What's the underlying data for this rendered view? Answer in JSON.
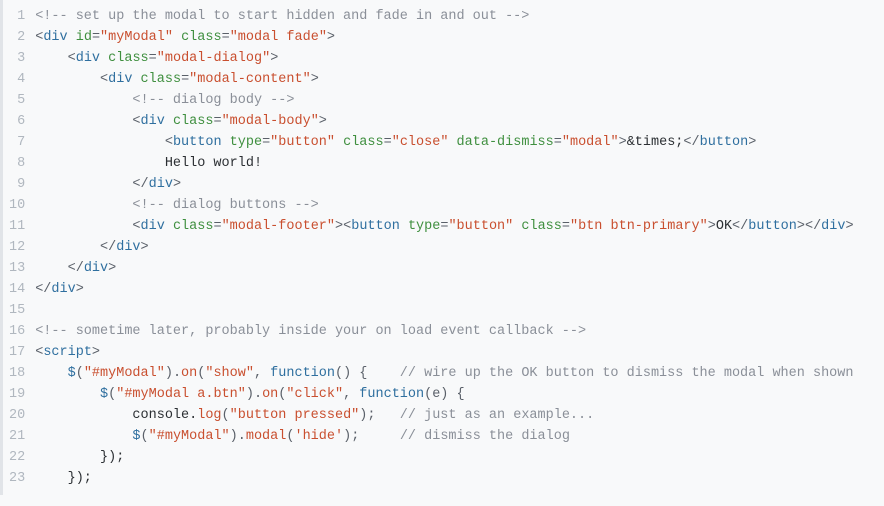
{
  "lineCount": 23,
  "lines": [
    [
      {
        "cls": "c",
        "t": "<!-- set up the modal to start hidden and fade in and out -->"
      }
    ],
    [
      {
        "cls": "p",
        "t": "<"
      },
      {
        "cls": "t",
        "t": "div"
      },
      {
        "cls": "n",
        "t": " "
      },
      {
        "cls": "a",
        "t": "id"
      },
      {
        "cls": "p",
        "t": "="
      },
      {
        "cls": "s",
        "t": "\"myModal\""
      },
      {
        "cls": "n",
        "t": " "
      },
      {
        "cls": "a",
        "t": "class"
      },
      {
        "cls": "p",
        "t": "="
      },
      {
        "cls": "s",
        "t": "\"modal fade\""
      },
      {
        "cls": "p",
        "t": ">"
      }
    ],
    [
      {
        "cls": "n",
        "t": "    "
      },
      {
        "cls": "p",
        "t": "<"
      },
      {
        "cls": "t",
        "t": "div"
      },
      {
        "cls": "n",
        "t": " "
      },
      {
        "cls": "a",
        "t": "class"
      },
      {
        "cls": "p",
        "t": "="
      },
      {
        "cls": "s",
        "t": "\"modal-dialog\""
      },
      {
        "cls": "p",
        "t": ">"
      }
    ],
    [
      {
        "cls": "n",
        "t": "        "
      },
      {
        "cls": "p",
        "t": "<"
      },
      {
        "cls": "t",
        "t": "div"
      },
      {
        "cls": "n",
        "t": " "
      },
      {
        "cls": "a",
        "t": "class"
      },
      {
        "cls": "p",
        "t": "="
      },
      {
        "cls": "s",
        "t": "\"modal-content\""
      },
      {
        "cls": "p",
        "t": ">"
      }
    ],
    [
      {
        "cls": "n",
        "t": "            "
      },
      {
        "cls": "c",
        "t": "<!-- dialog body -->"
      }
    ],
    [
      {
        "cls": "n",
        "t": "            "
      },
      {
        "cls": "p",
        "t": "<"
      },
      {
        "cls": "t",
        "t": "div"
      },
      {
        "cls": "n",
        "t": " "
      },
      {
        "cls": "a",
        "t": "class"
      },
      {
        "cls": "p",
        "t": "="
      },
      {
        "cls": "s",
        "t": "\"modal-body\""
      },
      {
        "cls": "p",
        "t": ">"
      }
    ],
    [
      {
        "cls": "n",
        "t": "                "
      },
      {
        "cls": "p",
        "t": "<"
      },
      {
        "cls": "t",
        "t": "button"
      },
      {
        "cls": "n",
        "t": " "
      },
      {
        "cls": "a",
        "t": "type"
      },
      {
        "cls": "p",
        "t": "="
      },
      {
        "cls": "s",
        "t": "\"button\""
      },
      {
        "cls": "n",
        "t": " "
      },
      {
        "cls": "a",
        "t": "class"
      },
      {
        "cls": "p",
        "t": "="
      },
      {
        "cls": "s",
        "t": "\"close\""
      },
      {
        "cls": "n",
        "t": " "
      },
      {
        "cls": "a",
        "t": "data-dismiss"
      },
      {
        "cls": "p",
        "t": "="
      },
      {
        "cls": "s",
        "t": "\"modal\""
      },
      {
        "cls": "p",
        "t": ">"
      },
      {
        "cls": "n",
        "t": "&times;"
      },
      {
        "cls": "p",
        "t": "</"
      },
      {
        "cls": "t",
        "t": "button"
      },
      {
        "cls": "p",
        "t": ">"
      }
    ],
    [
      {
        "cls": "n",
        "t": "                Hello world!"
      }
    ],
    [
      {
        "cls": "n",
        "t": "            "
      },
      {
        "cls": "p",
        "t": "</"
      },
      {
        "cls": "t",
        "t": "div"
      },
      {
        "cls": "p",
        "t": ">"
      }
    ],
    [
      {
        "cls": "n",
        "t": "            "
      },
      {
        "cls": "c",
        "t": "<!-- dialog buttons -->"
      }
    ],
    [
      {
        "cls": "n",
        "t": "            "
      },
      {
        "cls": "p",
        "t": "<"
      },
      {
        "cls": "t",
        "t": "div"
      },
      {
        "cls": "n",
        "t": " "
      },
      {
        "cls": "a",
        "t": "class"
      },
      {
        "cls": "p",
        "t": "="
      },
      {
        "cls": "s",
        "t": "\"modal-footer\""
      },
      {
        "cls": "p",
        "t": ">"
      },
      {
        "cls": "p",
        "t": "<"
      },
      {
        "cls": "t",
        "t": "button"
      },
      {
        "cls": "n",
        "t": " "
      },
      {
        "cls": "a",
        "t": "type"
      },
      {
        "cls": "p",
        "t": "="
      },
      {
        "cls": "s",
        "t": "\"button\""
      },
      {
        "cls": "n",
        "t": " "
      },
      {
        "cls": "a",
        "t": "class"
      },
      {
        "cls": "p",
        "t": "="
      },
      {
        "cls": "s",
        "t": "\"btn btn-primary\""
      },
      {
        "cls": "p",
        "t": ">"
      },
      {
        "cls": "n",
        "t": "OK"
      },
      {
        "cls": "p",
        "t": "</"
      },
      {
        "cls": "t",
        "t": "button"
      },
      {
        "cls": "p",
        "t": ">"
      },
      {
        "cls": "p",
        "t": "</"
      },
      {
        "cls": "t",
        "t": "div"
      },
      {
        "cls": "p",
        "t": ">"
      }
    ],
    [
      {
        "cls": "n",
        "t": "        "
      },
      {
        "cls": "p",
        "t": "</"
      },
      {
        "cls": "t",
        "t": "div"
      },
      {
        "cls": "p",
        "t": ">"
      }
    ],
    [
      {
        "cls": "n",
        "t": "    "
      },
      {
        "cls": "p",
        "t": "</"
      },
      {
        "cls": "t",
        "t": "div"
      },
      {
        "cls": "p",
        "t": ">"
      }
    ],
    [
      {
        "cls": "p",
        "t": "</"
      },
      {
        "cls": "t",
        "t": "div"
      },
      {
        "cls": "p",
        "t": ">"
      }
    ],
    [
      {
        "cls": "n",
        "t": ""
      }
    ],
    [
      {
        "cls": "c",
        "t": "<!-- sometime later, probably inside your on load event callback -->"
      }
    ],
    [
      {
        "cls": "p",
        "t": "<"
      },
      {
        "cls": "t",
        "t": "script"
      },
      {
        "cls": "p",
        "t": ">"
      }
    ],
    [
      {
        "cls": "n",
        "t": "    "
      },
      {
        "cls": "k",
        "t": "$"
      },
      {
        "cls": "p",
        "t": "("
      },
      {
        "cls": "s",
        "t": "\"#myModal\""
      },
      {
        "cls": "p",
        "t": ")."
      },
      {
        "cls": "fn",
        "t": "on"
      },
      {
        "cls": "p",
        "t": "("
      },
      {
        "cls": "s",
        "t": "\"show\""
      },
      {
        "cls": "p",
        "t": ", "
      },
      {
        "cls": "k",
        "t": "function"
      },
      {
        "cls": "p",
        "t": "() {    "
      },
      {
        "cls": "c",
        "t": "// wire up the OK button to dismiss the modal when shown"
      }
    ],
    [
      {
        "cls": "n",
        "t": "        "
      },
      {
        "cls": "k",
        "t": "$"
      },
      {
        "cls": "p",
        "t": "("
      },
      {
        "cls": "s",
        "t": "\"#myModal a.btn\""
      },
      {
        "cls": "p",
        "t": ")."
      },
      {
        "cls": "fn",
        "t": "on"
      },
      {
        "cls": "p",
        "t": "("
      },
      {
        "cls": "s",
        "t": "\"click\""
      },
      {
        "cls": "p",
        "t": ", "
      },
      {
        "cls": "k",
        "t": "function"
      },
      {
        "cls": "p",
        "t": "(e) {"
      }
    ],
    [
      {
        "cls": "n",
        "t": "            console."
      },
      {
        "cls": "fn",
        "t": "log"
      },
      {
        "cls": "p",
        "t": "("
      },
      {
        "cls": "s",
        "t": "\"button pressed\""
      },
      {
        "cls": "p",
        "t": ");   "
      },
      {
        "cls": "c",
        "t": "// just as an example..."
      }
    ],
    [
      {
        "cls": "n",
        "t": "            "
      },
      {
        "cls": "k",
        "t": "$"
      },
      {
        "cls": "p",
        "t": "("
      },
      {
        "cls": "s",
        "t": "\"#myModal\""
      },
      {
        "cls": "p",
        "t": ")."
      },
      {
        "cls": "fn",
        "t": "modal"
      },
      {
        "cls": "p",
        "t": "("
      },
      {
        "cls": "s",
        "t": "'hide'"
      },
      {
        "cls": "p",
        "t": ");     "
      },
      {
        "cls": "c",
        "t": "// dismiss the dialog"
      }
    ],
    [
      {
        "cls": "n",
        "t": "        });"
      }
    ],
    [
      {
        "cls": "n",
        "t": "    });"
      }
    ]
  ]
}
